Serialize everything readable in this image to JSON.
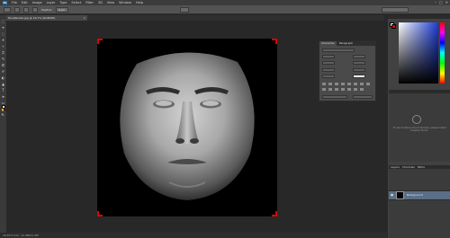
{
  "menubar": {
    "logo": "Ps",
    "items": [
      "File",
      "Edit",
      "Image",
      "Layer",
      "Type",
      "Select",
      "Filter",
      "3D",
      "View",
      "Window",
      "Help"
    ],
    "window_controls": [
      "–",
      "□",
      "✕"
    ]
  },
  "options": {
    "feather_label": "Feather:",
    "feather_value": "0 px"
  },
  "document": {
    "tab_title": "FaceRender.jpg @ 16.7% (RGB/8#)",
    "tab_close": "×"
  },
  "status": {
    "text": "16.67%   Doc: 11.4M/11.4M"
  },
  "float_panel": {
    "tabs": [
      "Character",
      "Paragraph"
    ]
  },
  "library_panel": {
    "message": "To use Creative Cloud Libraries, please install Creative Cloud."
  },
  "layers_panel": {
    "tabs": [
      "Layers",
      "Channels",
      "Paths"
    ],
    "selected_layer": "Background"
  },
  "toolbar": {
    "tools": [
      "⬚",
      "⌖",
      "◌",
      "✦",
      "⊹",
      "⌗",
      "✎",
      "⎚",
      "✐",
      "◐",
      "▲",
      "T",
      "➤",
      "▭",
      "✋",
      "🔍"
    ]
  },
  "colors": {
    "foreground": "#ffffff",
    "background": "#dd0000",
    "canvas_bg": "#000000",
    "crop_handle": "#e00000"
  }
}
